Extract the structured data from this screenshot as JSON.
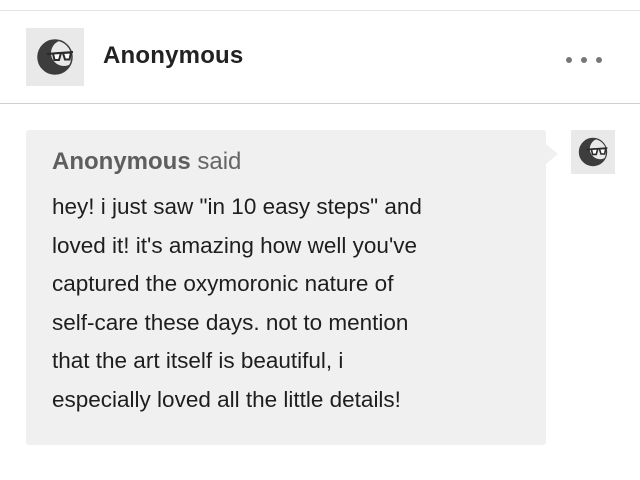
{
  "post": {
    "author": "Anonymous",
    "avatar_icon": "sunglasses-avatar-icon",
    "more_icon": "more-options-icon"
  },
  "ask": {
    "asker_name": "Anonymous",
    "said": "said",
    "question_lines": [
      "hey! i just saw \"in 10 easy steps\" and",
      "loved it! it's amazing how well you've",
      "captured the oxymoronic nature of",
      "self-care these days. not to mention",
      "that the art itself is beautiful, i",
      "especially loved all the little details!"
    ],
    "asker_avatar_icon": "sunglasses-avatar-icon"
  },
  "colors": {
    "bubble_background": "#f0f0f0",
    "avatar_background": "#e9e9e9",
    "avatar_face": "#3d3d3d",
    "text_primary": "#222222",
    "text_secondary": "#666666"
  }
}
